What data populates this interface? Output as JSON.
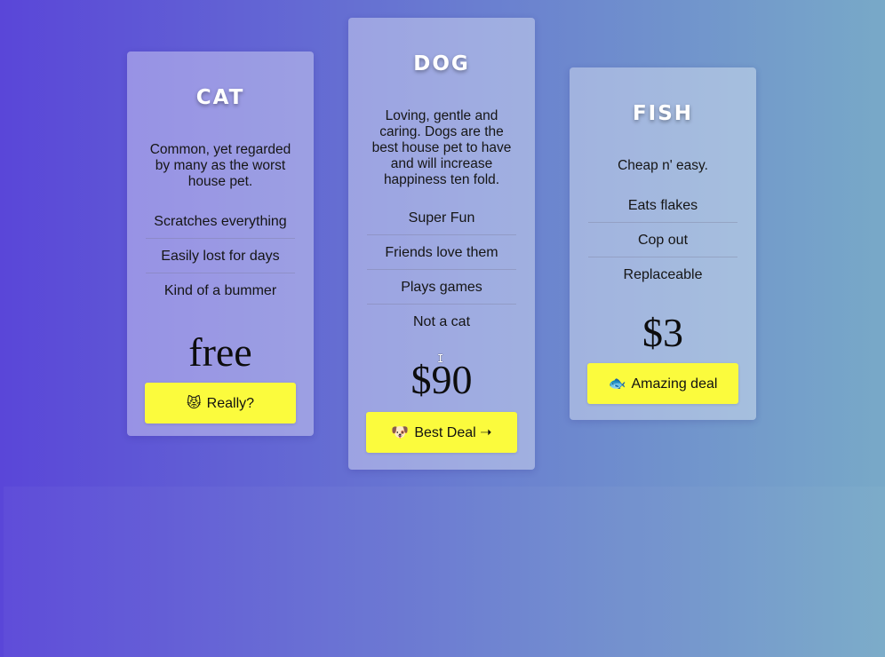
{
  "plans": [
    {
      "title": "CAT",
      "description": "Common, yet regarded by many as the worst house pet.",
      "features": [
        "Scratches everything",
        "Easily lost for days",
        "Kind of a bummer"
      ],
      "price": "free",
      "button_emoji": "😾",
      "button_label": "Really?"
    },
    {
      "title": "DOG",
      "description": "Loving, gentle and caring. Dogs are the best house pet to have and will increase happiness ten fold.",
      "features": [
        "Super Fun",
        "Friends love them",
        "Plays games",
        "Not a cat"
      ],
      "price": "$90",
      "button_emoji": "🐶",
      "button_label": "Best Deal ➝"
    },
    {
      "title": "FISH",
      "description": "Cheap n' easy.",
      "features": [
        "Eats flakes",
        "Cop out",
        "Replaceable"
      ],
      "price": "$3",
      "button_emoji": "🐟",
      "button_label": "Amazing deal"
    }
  ],
  "colors": {
    "background_start": "#5a46d8",
    "background_end": "#78a9c8",
    "button_bg": "#fbfb3d",
    "title_text": "#ffffff"
  }
}
